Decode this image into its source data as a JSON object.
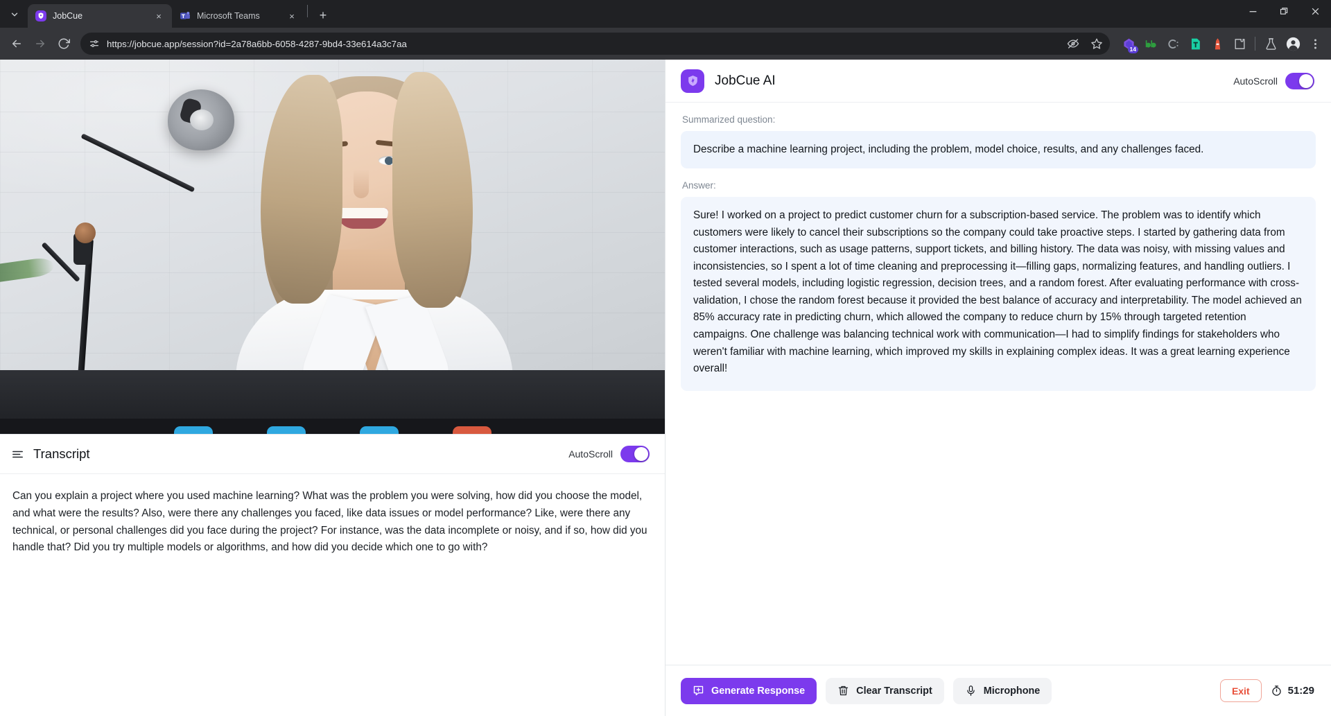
{
  "browser": {
    "tabs": [
      {
        "title": "JobCue",
        "favicon": "jobcue-shield-icon",
        "active": true,
        "close_label": "×"
      },
      {
        "title": "Microsoft Teams",
        "favicon": "microsoft-teams-icon",
        "active": false,
        "close_label": "×"
      }
    ],
    "new_tab_label": "+",
    "tab_search_icon": "chevron-down-icon",
    "nav": {
      "back_icon": "back-arrow-icon",
      "forward_icon": "forward-arrow-icon",
      "reload_icon": "reload-icon"
    },
    "address": {
      "site_info_icon": "site-settings-icon",
      "url": "https://jobcue.app/session?id=2a78a6bb-6058-4287-9bd4-33e614a3c7aa",
      "tracking_icon": "eye-slash-icon",
      "bookmark_icon": "star-icon"
    },
    "extensions": [
      {
        "name": "purple-extension-icon",
        "badge": "14",
        "color": "#7b4fe0"
      },
      {
        "name": "bb-extension-icon",
        "badge": "",
        "color": "#2e9e3f"
      },
      {
        "name": "c-extension-icon",
        "badge": "",
        "color": "#9aa0a6"
      },
      {
        "name": "teal-document-extension-icon",
        "badge": "",
        "color": "#19cfa3"
      },
      {
        "name": "red-lighthouse-extension-icon",
        "badge": "",
        "color": "#e8563c"
      },
      {
        "name": "puzzle-extensions-icon",
        "badge": "",
        "color": "#c3c6ca"
      },
      {
        "name": "flask-labs-icon",
        "badge": "",
        "color": "#c3c6ca"
      },
      {
        "name": "profile-avatar-icon",
        "badge": "",
        "color": "#e8eaed"
      },
      {
        "name": "chrome-menu-icon",
        "badge": "",
        "color": "#c3c6ca"
      }
    ],
    "window_controls": {
      "minimize_icon": "minimize-icon",
      "maximize_icon": "restore-icon",
      "close_icon": "close-icon"
    }
  },
  "video": {
    "alt": "interview-video-feed",
    "controls": [
      "camera-control",
      "mic-control",
      "share-control",
      "leave-control"
    ]
  },
  "transcript": {
    "menu_icon": "hamburger-menu-icon",
    "title": "Transcript",
    "autoscroll_label": "AutoScroll",
    "autoscroll_on": true,
    "text": "Can you explain a project where you used machine learning? What was the problem you were solving, how did you choose the model, and what were the results? Also, were there any challenges you faced, like data issues or model performance? Like, were there any technical, or personal challenges did you face during the project? For instance, was the data incomplete or noisy, and if so, how did you handle that? Did you try multiple models or algorithms, and how did you decide which one to go with?"
  },
  "assistant": {
    "logo_icon": "jobcue-sparkle-icon",
    "name": "JobCue AI",
    "autoscroll_label": "AutoScroll",
    "autoscroll_on": true,
    "question_label": "Summarized question:",
    "question": "Describe a machine learning project, including the problem, model choice, results, and any challenges faced.",
    "answer_label": "Answer:",
    "answer": "Sure! I worked on a project to predict customer churn for a subscription-based service. The problem was to identify which customers were likely to cancel their subscriptions so the company could take proactive steps. I started by gathering data from customer interactions, such as usage patterns, support tickets, and billing history. The data was noisy, with missing values and inconsistencies, so I spent a lot of time cleaning and preprocessing it—filling gaps, normalizing features, and handling outliers. I tested several models, including logistic regression, decision trees, and a random forest. After evaluating performance with cross-validation, I chose the random forest because it provided the best balance of accuracy and interpretability. The model achieved an 85% accuracy rate in predicting churn, which allowed the company to reduce churn by 15% through targeted retention campaigns. One challenge was balancing technical work with communication—I had to simplify findings for stakeholders who weren't familiar with machine learning, which improved my skills in explaining complex ideas. It was a great learning experience overall!",
    "footer": {
      "generate_label": "Generate Response",
      "generate_icon": "message-plus-icon",
      "clear_label": "Clear Transcript",
      "clear_icon": "trash-icon",
      "microphone_label": "Microphone",
      "microphone_icon": "microphone-icon",
      "exit_label": "Exit",
      "timer_icon": "stopwatch-icon",
      "timer": "51:29"
    }
  },
  "colors": {
    "accent": "#7c3aed",
    "question_bg": "#eef4fd",
    "answer_bg": "#f2f6fd",
    "exit_red": "#e8503a",
    "chrome_bg": "#202124",
    "toolbar_bg": "#35363a"
  }
}
